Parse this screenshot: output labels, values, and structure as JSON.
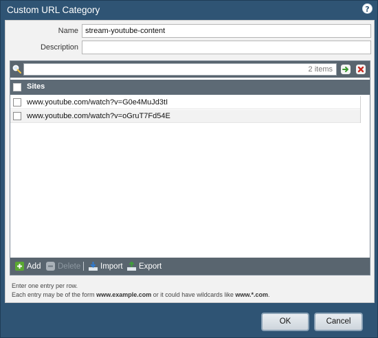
{
  "dialog": {
    "title": "Custom URL Category",
    "help_glyph": "?"
  },
  "form": {
    "name_label": "Name",
    "name_value": "stream-youtube-content",
    "description_label": "Description",
    "description_value": ""
  },
  "grid": {
    "search_value": "",
    "items_count": "2 items",
    "column_header": "Sites",
    "rows": [
      {
        "site": "www.youtube.com/watch?v=G0e4MuJd3tI",
        "checked": false
      },
      {
        "site": "www.youtube.com/watch?v=oGruT7Fd54E",
        "checked": false
      }
    ]
  },
  "toolbar": {
    "add_label": "Add",
    "delete_label": "Delete",
    "import_label": "Import",
    "export_label": "Export"
  },
  "hints": {
    "line1": "Enter one entry per row.",
    "line2_prefix": "Each entry may be of the form ",
    "line2_example": "www.example.com",
    "line2_middle": " or it could have wildcards like ",
    "line2_wildcard": "www.*.com",
    "line2_suffix": "."
  },
  "footer": {
    "ok_label": "OK",
    "cancel_label": "Cancel"
  },
  "colors": {
    "frame": "#2f5474",
    "grid_header": "#5d6a75",
    "toolbar": "#59656f",
    "add_green": "#5aa832",
    "export_green": "#3f9e3a"
  }
}
